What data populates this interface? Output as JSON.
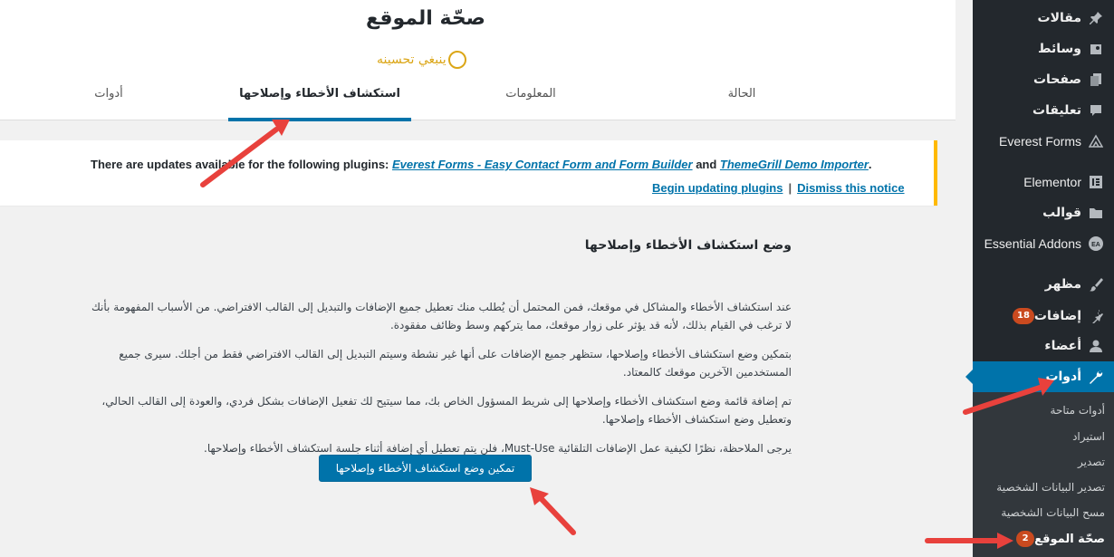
{
  "page": {
    "title": "صحّة الموقع",
    "health_status": "ينبغي تحسينه",
    "tabs": [
      {
        "label": "الحالة"
      },
      {
        "label": "المعلومات"
      },
      {
        "label": "استكشاف الأخطاء وإصلاحها"
      },
      {
        "label": "أدوات"
      }
    ]
  },
  "notice": {
    "prefix": "There are updates available for the following plugins: ",
    "plugin1": "Everest Forms - Easy Contact Form and Form Builder",
    "and": " and ",
    "plugin2": "ThemeGrill Demo Importer",
    "suffix": ".",
    "begin_link": "Begin updating plugins",
    "separator": "|",
    "dismiss_link": "Dismiss this notice",
    "border_color": "#ffb900"
  },
  "content": {
    "heading": "وضع استكشاف الأخطاء وإصلاحها",
    "p1": "عند استكشاف الأخطاء والمشاكل في موقعك، فمن المحتمل أن يُطلب منك تعطيل جميع الإضافات والتبديل إلى القالب الافتراضي. من الأسباب المفهومة بأنك لا ترغب في القيام بذلك، لأنه قد يؤثر على زوار موقعك، مما يتركهم وسط وظائف مفقودة.",
    "p2": "بتمكين وضع استكشاف الأخطاء وإصلاحها، ستظهر جميع الإضافات على أنها غير نشطة وسيتم التبديل إلى القالب الافتراضي فقط من أجلك. سيرى جميع المستخدمين الآخرين موقعك كالمعتاد.",
    "p3": "تم إضافة قائمة وضع استكشاف الأخطاء وإصلاحها إلى شريط المسؤول الخاص بك، مما سيتيح لك تفعيل الإضافات بشكل فردي، والعودة إلى القالب الحالي، وتعطيل وضع استكشاف الأخطاء وإصلاحها.",
    "p4": "يرجى الملاحظة، نظرًا لكيفية عمل الإضافات التلقائية Must-Use، فلن يتم تعطيل أي إضافة أثناء جلسة استكشاف الأخطاء وإصلاحها.",
    "enable_button": "تمكين وضع استكشاف الأخطاء وإصلاحها"
  },
  "sidebar": {
    "items": [
      {
        "label": "مقالات",
        "icon": "pin-icon"
      },
      {
        "label": "وسائط",
        "icon": "media-icon"
      },
      {
        "label": "صفحات",
        "icon": "pages-icon"
      },
      {
        "label": "تعليقات",
        "icon": "comments-icon"
      },
      {
        "label": "Everest Forms",
        "icon": "everest-icon"
      },
      {
        "label": "Elementor",
        "icon": "elementor-icon"
      },
      {
        "label": "قوالب",
        "icon": "folder-icon"
      },
      {
        "label": "Essential Addons",
        "icon": "ea-icon"
      },
      {
        "label": "مظهر",
        "icon": "brush-icon"
      },
      {
        "label": "إضافات",
        "icon": "plugin-icon",
        "badge": "18"
      },
      {
        "label": "أعضاء",
        "icon": "user-icon"
      },
      {
        "label": "أدوات",
        "icon": "wrench-icon"
      }
    ],
    "submenu": [
      {
        "label": "أدوات متاحة"
      },
      {
        "label": "استيراد"
      },
      {
        "label": "تصدير"
      },
      {
        "label": "تصدير البيانات الشخصية"
      },
      {
        "label": "مسح البيانات الشخصية"
      },
      {
        "label": "صحّة الموقع",
        "badge": "2"
      }
    ],
    "background": "#23282d",
    "active_color": "#0073aa"
  }
}
